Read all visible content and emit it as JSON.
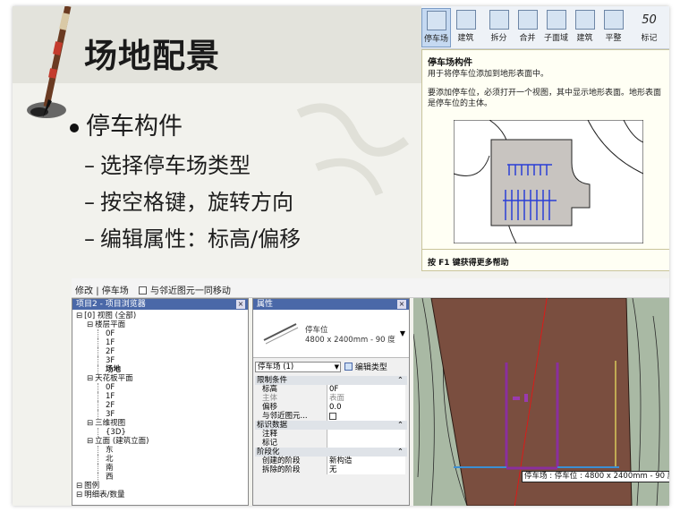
{
  "slide": {
    "title": "场地配景",
    "main_bullet": "停车构件",
    "sub_bullets": [
      "选择停车场类型",
      "按空格键，旋转方向",
      "编辑属性：标高/偏移"
    ],
    "sub_marker": "–"
  },
  "ribbon": {
    "buttons": [
      {
        "label": "停车场",
        "icon": "parking-icon"
      },
      {
        "label": "建筑",
        "icon": "building-icon"
      },
      {
        "label": "拆分",
        "icon": "split-surface-icon"
      },
      {
        "label": "合并",
        "icon": "merge-surface-icon"
      },
      {
        "label": "子面域",
        "icon": "subregion-icon"
      },
      {
        "label": "建筑",
        "icon": "building-pad-icon"
      },
      {
        "label": "平整",
        "icon": "graded-region-icon"
      },
      {
        "label": "标记",
        "icon": "label-contours-icon"
      }
    ],
    "mark_value": "50"
  },
  "tooltip": {
    "title": "停车场构件",
    "line": "用于将停车位添加到地形表面中。",
    "description": "要添加停车位，必须打开一个视图，其中显示地形表面。地形表面是停车位的主体。",
    "footer": "按 F1 键获得更多帮助"
  },
  "options_bar": {
    "modify": "修改",
    "separator": "|",
    "context": "停车场",
    "checkbox_label": "与邻近图元一同移动"
  },
  "project_browser": {
    "title": "项目2 - 项目浏览器",
    "close": "×",
    "items": [
      {
        "label": "[0] 视图 (全部)",
        "level": 0,
        "toggle": "⊟"
      },
      {
        "label": "楼层平面",
        "level": 1,
        "toggle": "⊟"
      },
      {
        "label": "0F",
        "level": 2,
        "toggle": ""
      },
      {
        "label": "1F",
        "level": 2,
        "toggle": ""
      },
      {
        "label": "2F",
        "level": 2,
        "toggle": ""
      },
      {
        "label": "3F",
        "level": 2,
        "toggle": ""
      },
      {
        "label": "场地",
        "level": 2,
        "toggle": "",
        "selected": true
      },
      {
        "label": "天花板平面",
        "level": 1,
        "toggle": "⊟"
      },
      {
        "label": "0F",
        "level": 2,
        "toggle": ""
      },
      {
        "label": "1F",
        "level": 2,
        "toggle": ""
      },
      {
        "label": "2F",
        "level": 2,
        "toggle": ""
      },
      {
        "label": "3F",
        "level": 2,
        "toggle": ""
      },
      {
        "label": "三维视图",
        "level": 1,
        "toggle": "⊟"
      },
      {
        "label": "{3D}",
        "level": 2,
        "toggle": ""
      },
      {
        "label": "立面 (建筑立面)",
        "level": 1,
        "toggle": "⊟"
      },
      {
        "label": "东",
        "level": 2,
        "toggle": ""
      },
      {
        "label": "北",
        "level": 2,
        "toggle": ""
      },
      {
        "label": "南",
        "level": 2,
        "toggle": ""
      },
      {
        "label": "西",
        "level": 2,
        "toggle": ""
      },
      {
        "label": "图例",
        "level": 0,
        "toggle": "⊟"
      },
      {
        "label": "明细表/数量",
        "level": 0,
        "toggle": "⊟"
      }
    ]
  },
  "properties": {
    "title": "属性",
    "close": "×",
    "family": "停车位",
    "type": "4800 x 2400mm - 90 度",
    "selector": "停车场 (1)",
    "edit_type": "编辑类型",
    "groups": [
      {
        "name": "限制条件",
        "rows": [
          {
            "key": "标高",
            "value": "0F"
          },
          {
            "key": "主体",
            "value": "表面",
            "muted": true
          },
          {
            "key": "偏移",
            "value": "0.0"
          },
          {
            "key": "与邻近图元...",
            "value": "checkbox"
          }
        ]
      },
      {
        "name": "标识数据",
        "rows": [
          {
            "key": "注释",
            "value": ""
          },
          {
            "key": "标记",
            "value": ""
          }
        ]
      },
      {
        "name": "阶段化",
        "rows": [
          {
            "key": "创建的阶段",
            "value": "新构造"
          },
          {
            "key": "拆除的阶段",
            "value": "无"
          }
        ]
      }
    ]
  },
  "view": {
    "tooltip": "停车场 : 停车位 : 4800 x 2400mm - 90 度"
  },
  "colors": {
    "terrain": "#7a4e3f",
    "parking": "#8a2f9e",
    "browser_header": "#4a68a8"
  }
}
